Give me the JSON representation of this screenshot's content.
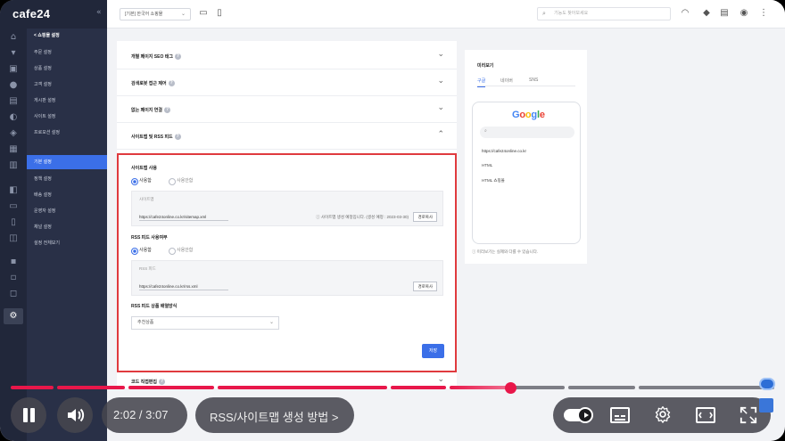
{
  "app": {
    "logo": "cafe24",
    "colors": {
      "accent": "#3b6fe8",
      "sidebar_bg": "#293047",
      "rail_bg": "#21273a",
      "highlight": "#e03a3e",
      "player_red": "#e8174a"
    }
  },
  "rail_icons": [
    "home-icon",
    "cart-icon",
    "box-icon",
    "user-icon",
    "board-icon",
    "design-icon",
    "promo-icon",
    "stats-icon",
    "report-icon",
    "app-icon",
    "store-icon",
    "mobile-icon",
    "gift-icon",
    "apps-grid-icon",
    "settings-icon"
  ],
  "sidebar": {
    "back_label": "< 쇼핑몰 설정",
    "items": [
      "주문 설정",
      "상품 설정",
      "고객 설정",
      "게시판 설정",
      "사이트 설정",
      "프로모션 설정",
      "기본 설정",
      "정책 설정",
      "배송 설정",
      "운영자 설정",
      "채널 설정",
      "설정 전체보기"
    ],
    "active_index": 6
  },
  "topbar": {
    "shop_select": "[기본] 한국어 쇼핑몰",
    "search_placeholder": "기능도 찾아보세요"
  },
  "main": {
    "accordion": [
      {
        "label": "개별 페이지 SEO 태그",
        "expanded": false
      },
      {
        "label": "검색로봇 접근 제어",
        "expanded": false
      },
      {
        "label": "없는 페이지 연결",
        "expanded": false
      },
      {
        "label": "사이트맵 및 RSS 피드",
        "expanded": true
      }
    ],
    "sitemap": {
      "title": "사이트맵 사용",
      "radio_on": "사용함",
      "radio_off": "사용안함",
      "box_label": "사이트맵",
      "url": "https://cafe24online.co.kr/sitemap.xml",
      "note": "ⓘ 사이트맵 생성 예정입니다. (생성 예정 : 2023-03-30)",
      "copy_button": "경로복사"
    },
    "rss": {
      "title": "RSS 피드 사용여부",
      "radio_on": "사용함",
      "radio_off": "사용안함",
      "box_label": "RSS 피드",
      "url": "https://cafe24online.co.kr/rss.xml",
      "copy_button": "경로복사"
    },
    "rss_sort": {
      "title": "RSS 피드 상품 배열방식",
      "selected": "추천상품"
    },
    "save_button": "저장",
    "next_row_label": "코드 직접편집"
  },
  "preview": {
    "title": "미리보기",
    "tabs": [
      "구글",
      "네이버",
      "SNS"
    ],
    "active_tab": 0,
    "google_logo": "Google",
    "result_url": "https://cafe24online.co.kr",
    "result_title": "HTML",
    "result_desc": "HTML 쇼핑몰",
    "note": "ⓘ 미리보기는 실제와 다를 수 있습니다."
  },
  "player": {
    "time": "2:02 / 3:07",
    "chapter": "RSS/사이트맵 생성 방법 >",
    "progress": 0.652
  }
}
